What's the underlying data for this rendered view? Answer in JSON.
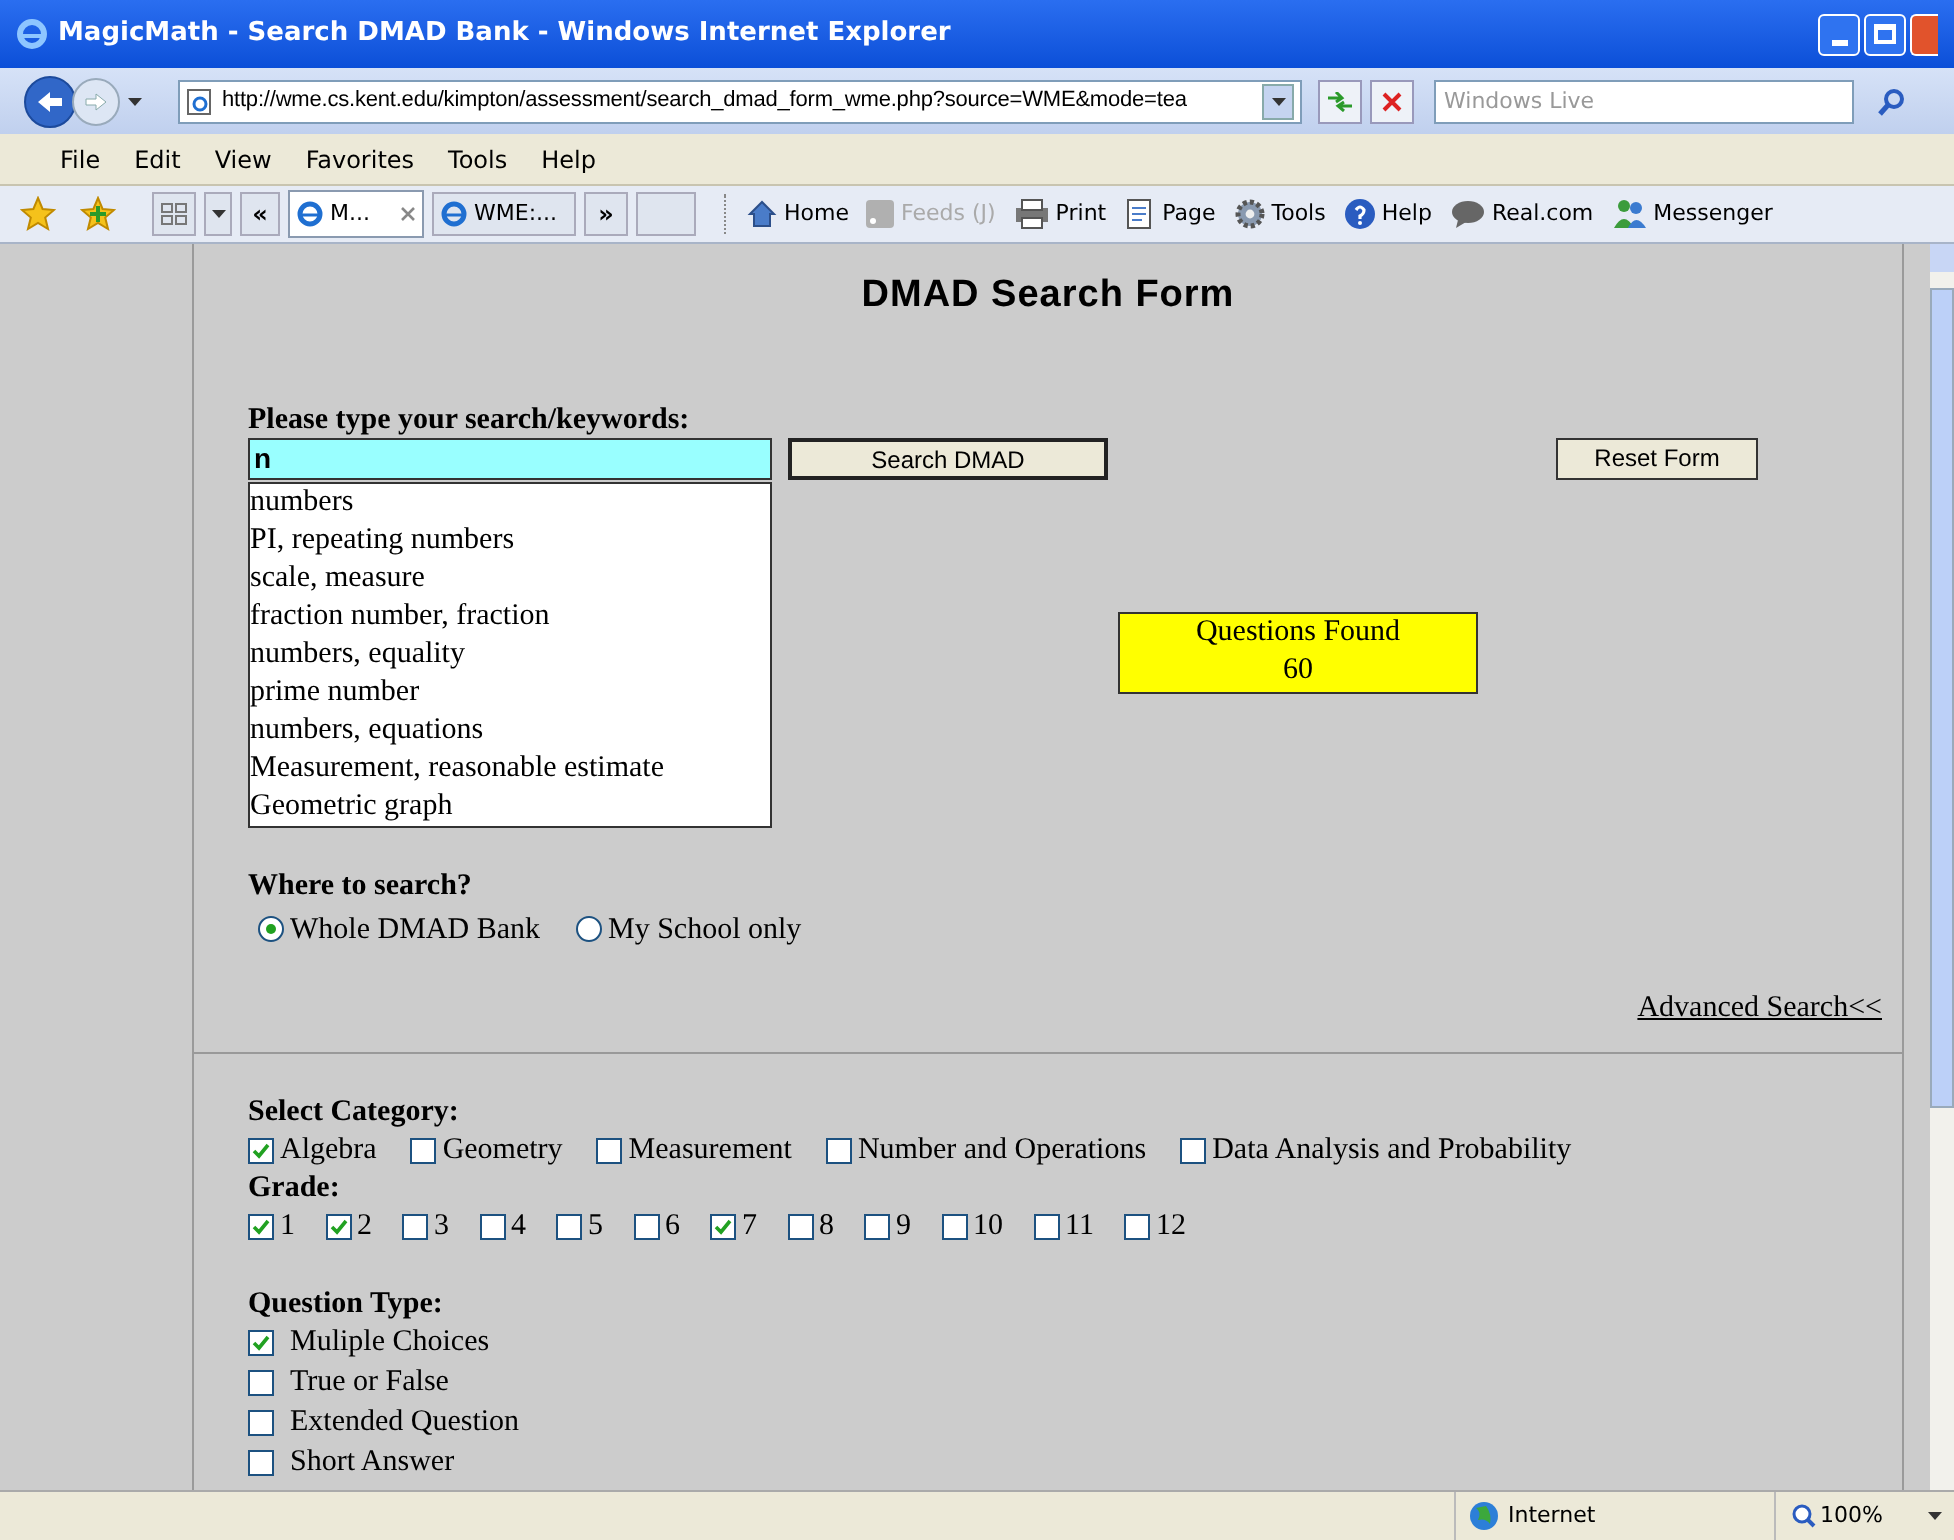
{
  "window": {
    "title": "MagicMath - Search DMAD Bank - Windows Internet Explorer"
  },
  "address_bar": {
    "url": "http://wme.cs.kent.edu/kimpton/assessment/search_dmad_form_wme.php?source=WME&mode=tea"
  },
  "search_box": {
    "placeholder": "Windows Live"
  },
  "menu": [
    "File",
    "Edit",
    "View",
    "Favorites",
    "Tools",
    "Help"
  ],
  "tabs": [
    {
      "label": "M...",
      "selected": true
    },
    {
      "label": "WME:...",
      "selected": false
    }
  ],
  "tab_overflow": "»",
  "tab_back": "«",
  "toolbar": [
    {
      "kind": "home",
      "label": "Home",
      "disabled": false
    },
    {
      "kind": "feeds",
      "label": "Feeds (J)",
      "disabled": true
    },
    {
      "kind": "print",
      "label": "Print",
      "disabled": false
    },
    {
      "kind": "page",
      "label": "Page",
      "disabled": false
    },
    {
      "kind": "tools",
      "label": "Tools",
      "disabled": false
    },
    {
      "kind": "help",
      "label": "Help",
      "disabled": false
    },
    {
      "kind": "realcom",
      "label": "Real.com",
      "disabled": false
    },
    {
      "kind": "messenger",
      "label": "Messenger",
      "disabled": false
    }
  ],
  "page": {
    "heading": "DMAD Search Form",
    "search_label": "Please type your search/keywords:",
    "search_value": "n",
    "suggestions": [
      "numbers",
      "PI, repeating numbers",
      "scale, measure",
      "fraction number, fraction",
      "numbers, equality",
      "prime number",
      "numbers, equations",
      "Measurement, reasonable estimate",
      "Geometric graph"
    ],
    "search_button": "Search DMAD",
    "reset_button": "Reset Form",
    "results": {
      "label": "Questions Found",
      "count": "60"
    },
    "where_label": "Where to search?",
    "where_options": [
      {
        "label": "Whole DMAD Bank",
        "selected": true
      },
      {
        "label": "My School only",
        "selected": false
      }
    ],
    "advanced_link": "Advanced Search<<",
    "category_label": "Select Category:",
    "categories": [
      {
        "label": "Algebra",
        "checked": true
      },
      {
        "label": "Geometry",
        "checked": false
      },
      {
        "label": "Measurement",
        "checked": false
      },
      {
        "label": "Number and Operations",
        "checked": false
      },
      {
        "label": "Data Analysis and Probability",
        "checked": false
      }
    ],
    "grade_label": "Grade:",
    "grades": [
      {
        "label": "1",
        "checked": true
      },
      {
        "label": "2",
        "checked": true
      },
      {
        "label": "3",
        "checked": false
      },
      {
        "label": "4",
        "checked": false
      },
      {
        "label": "5",
        "checked": false
      },
      {
        "label": "6",
        "checked": false
      },
      {
        "label": "7",
        "checked": true
      },
      {
        "label": "8",
        "checked": false
      },
      {
        "label": "9",
        "checked": false
      },
      {
        "label": "10",
        "checked": false
      },
      {
        "label": "11",
        "checked": false
      },
      {
        "label": "12",
        "checked": false
      }
    ],
    "type_label": "Question Type:",
    "question_types": [
      {
        "label": "Muliple Choices",
        "checked": true
      },
      {
        "label": "True or False",
        "checked": false
      },
      {
        "label": "Extended Question",
        "checked": false
      },
      {
        "label": "Short Answer",
        "checked": false
      }
    ]
  },
  "status_bar": {
    "zone": "Internet",
    "zoom": "100%"
  }
}
